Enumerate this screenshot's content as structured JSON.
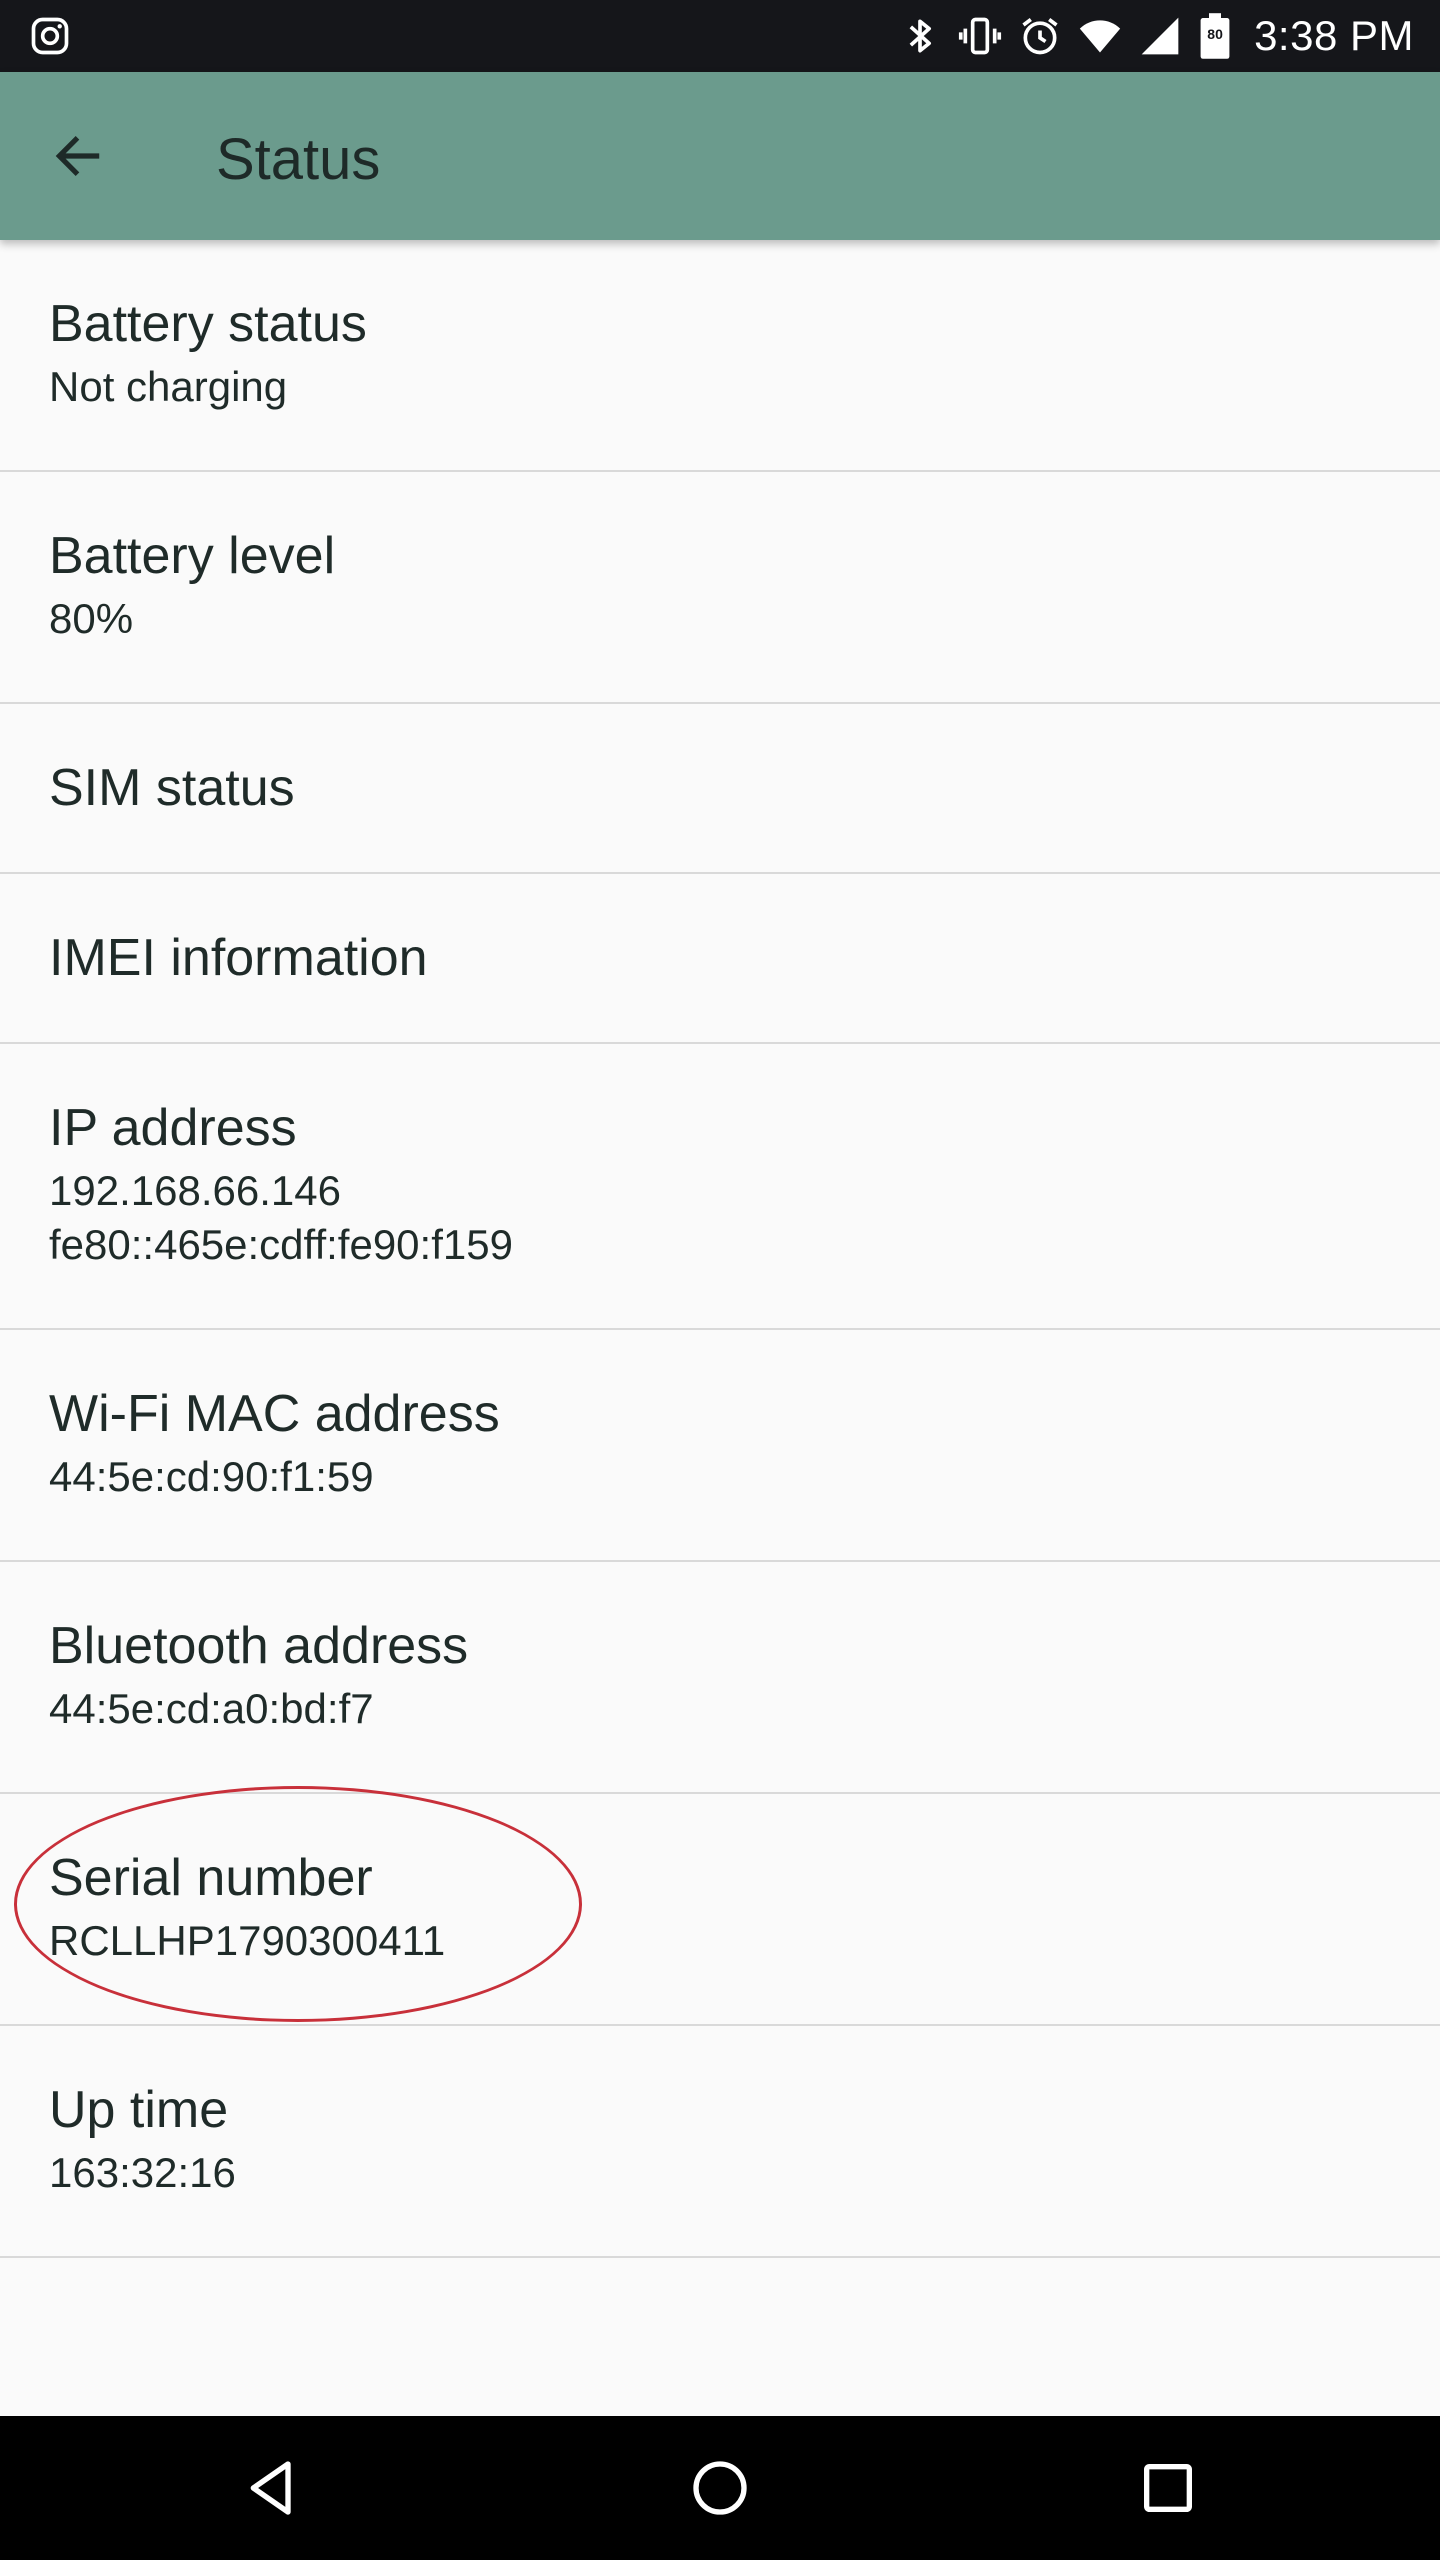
{
  "status_bar": {
    "time": "3:38 PM",
    "battery_percent": "80",
    "icons": [
      "instagram-icon",
      "bluetooth-icon",
      "vibrate-icon",
      "alarm-icon",
      "wifi-icon",
      "cellular-signal-icon",
      "battery-icon"
    ]
  },
  "app_bar": {
    "title": "Status",
    "back_icon": "arrow-back-icon"
  },
  "items": [
    {
      "title": "Battery status",
      "summary": "Not charging"
    },
    {
      "title": "Battery level",
      "summary": "80%"
    },
    {
      "title": "SIM status"
    },
    {
      "title": "IMEI information"
    },
    {
      "title": "IP address",
      "summary_lines": [
        "192.168.66.146",
        "fe80::465e:cdff:fe90:f159"
      ]
    },
    {
      "title": "Wi-Fi MAC address",
      "summary": "44:5e:cd:90:f1:59"
    },
    {
      "title": "Bluetooth address",
      "summary": "44:5e:cd:a0:bd:f7"
    },
    {
      "title": "Serial number",
      "summary": "RCLLHP1790300411"
    },
    {
      "title": "Up time",
      "summary": "163:32:16"
    }
  ],
  "annotation": {
    "color": "#c8303a"
  },
  "navigation_bar": {
    "buttons": [
      "nav-back-icon",
      "nav-home-icon",
      "nav-recents-icon"
    ]
  },
  "colors": {
    "app_bar": "#6b9b8d",
    "status_bar": "#15161a",
    "background": "#fafafa",
    "text": "#1f2b29",
    "divider": "#d9d9d9"
  }
}
